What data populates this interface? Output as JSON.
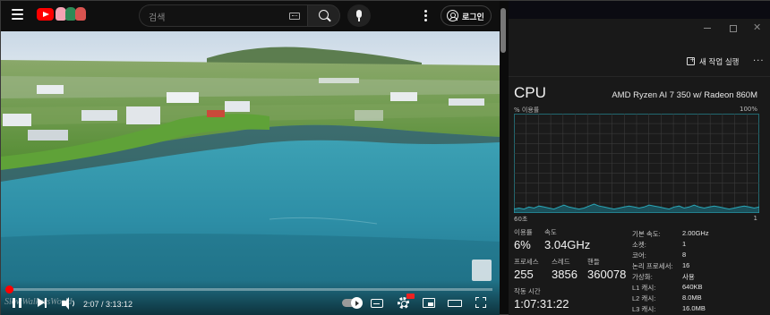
{
  "youtube": {
    "search": {
      "placeholder": "검색"
    },
    "login_label": "로그인",
    "player": {
      "time": "2:07 / 3:13:12",
      "progress_fraction": 0.011,
      "channel_watermark": "SlowWalkersWorld"
    }
  },
  "taskmanager": {
    "new_task_label": "새 작업 실행",
    "more_label": "···",
    "cpu": {
      "title": "CPU",
      "model": "AMD Ryzen AI 7 350 w/ Radeon 860M",
      "graph_top_left": "% 이용률",
      "graph_top_right": "100%",
      "graph_bottom_left": "60초",
      "graph_bottom_right": "1",
      "stats": {
        "utilization_label": "이용률",
        "utilization_value": "6%",
        "speed_label": "속도",
        "speed_value": "3.04GHz",
        "processes_label": "프로세스",
        "processes_value": "255",
        "threads_label": "스레드",
        "threads_value": "3856",
        "handles_label": "핸들",
        "handles_value": "360078",
        "uptime_label": "작동 시간",
        "uptime_value": "1:07:31:22"
      },
      "details": [
        {
          "key": "기본 속도:",
          "value": "2.00GHz"
        },
        {
          "key": "소켓:",
          "value": "1"
        },
        {
          "key": "코어:",
          "value": "8"
        },
        {
          "key": "논리 프로세서:",
          "value": "16"
        },
        {
          "key": "가상화:",
          "value": "사용"
        },
        {
          "key": "L1 캐시:",
          "value": "640KB"
        },
        {
          "key": "L2 캐시:",
          "value": "8.0MB"
        },
        {
          "key": "L3 캐시:",
          "value": "16.0MB"
        }
      ],
      "graph_utilization_percent": [
        4,
        5,
        4,
        6,
        5,
        7,
        6,
        5,
        4,
        6,
        8,
        6,
        5,
        4,
        5,
        7,
        9,
        7,
        6,
        5,
        4,
        5,
        6,
        7,
        6,
        5,
        6,
        8,
        7,
        6,
        5,
        4,
        6,
        7,
        5,
        6,
        8,
        6,
        5,
        6,
        7,
        6,
        5,
        4,
        5,
        6,
        7,
        6,
        5,
        6
      ],
      "accent_color": "#2aa7b8"
    }
  }
}
